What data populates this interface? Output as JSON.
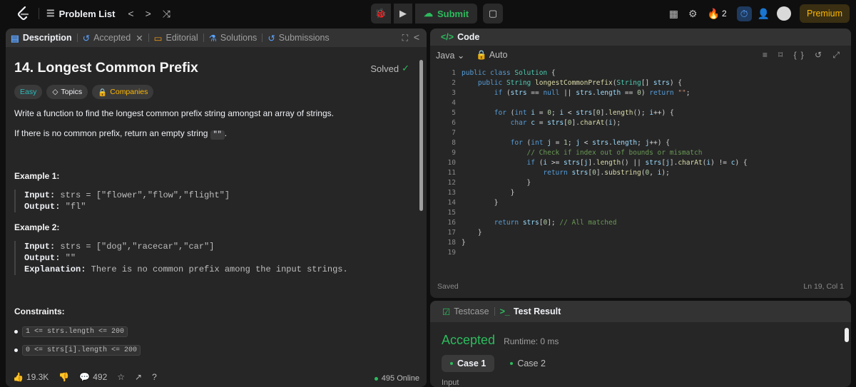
{
  "topbar": {
    "problem_list": "Problem List",
    "submit": "Submit",
    "streak": "2",
    "premium": "Premium"
  },
  "left": {
    "tabs": [
      "Description",
      "Accepted",
      "Editorial",
      "Solutions",
      "Submissions"
    ],
    "title": "14. Longest Common Prefix",
    "solved": "Solved",
    "badges": [
      "Easy",
      "Topics",
      "Companies"
    ],
    "para1": "Write a function to find the longest common prefix string amongst an array of strings.",
    "para2_pre": "If there is no common prefix, return an empty string ",
    "para2_code": "\"\"",
    "para2_post": ".",
    "example1_title": "Example 1:",
    "example1_input_label": "Input:",
    "example1_input": "strs = [\"flower\",\"flow\",\"flight\"]",
    "example1_output_label": "Output:",
    "example1_output": "\"fl\"",
    "example2_title": "Example 2:",
    "example2_input_label": "Input:",
    "example2_input": "strs = [\"dog\",\"racecar\",\"car\"]",
    "example2_output_label": "Output:",
    "example2_output": "\"\"",
    "example2_expl_label": "Explanation:",
    "example2_expl": "There is no common prefix among the input strings.",
    "constraints_title": "Constraints:",
    "constraints": [
      "1 <= strs.length <= 200",
      "0 <= strs[i].length <= 200"
    ],
    "likes": "19.3K",
    "comments": "492",
    "online": "495 Online"
  },
  "code": {
    "tab": "Code",
    "lang": "Java",
    "auto": "Auto",
    "saved": "Saved",
    "cursor": "Ln 19, Col 1"
  },
  "result": {
    "tab_testcase": "Testcase",
    "tab_result": "Test Result",
    "status": "Accepted",
    "runtime": "Runtime: 0 ms",
    "case1": "Case 1",
    "case2": "Case 2",
    "input_label": "Input"
  }
}
